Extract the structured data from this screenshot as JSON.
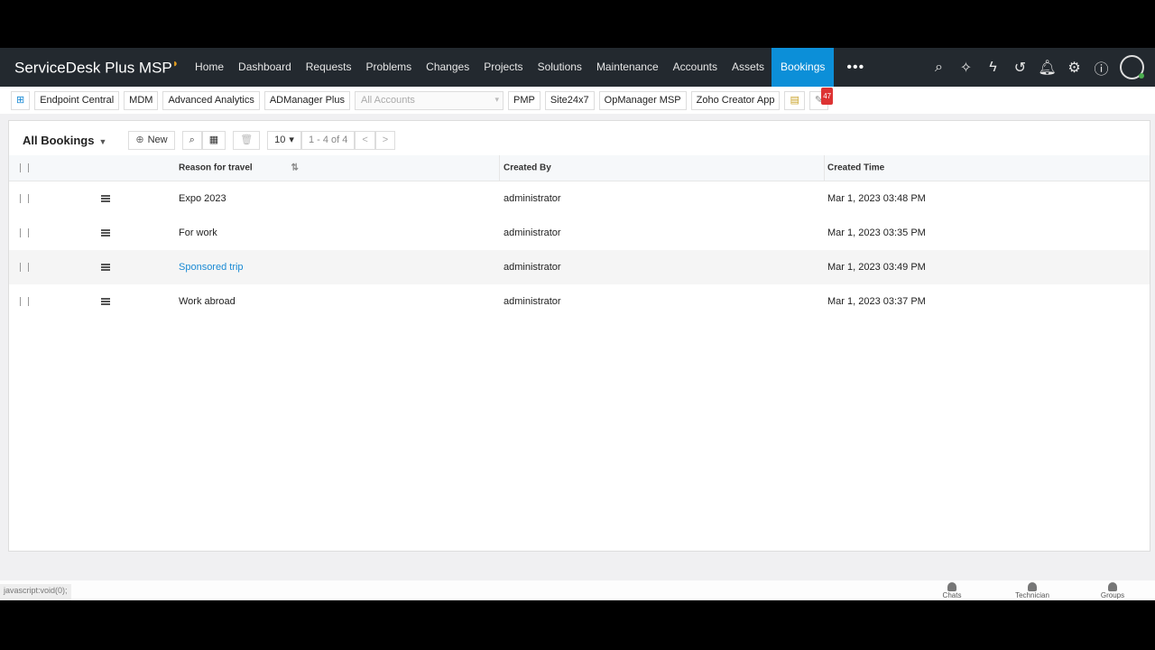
{
  "app": {
    "logo": "ServiceDesk Plus MSP"
  },
  "nav": {
    "items": [
      "Home",
      "Dashboard",
      "Requests",
      "Problems",
      "Changes",
      "Projects",
      "Solutions",
      "Maintenance",
      "Accounts",
      "Assets",
      "Bookings"
    ],
    "active": "Bookings",
    "more": "•••"
  },
  "toolbar": {
    "links": [
      "Endpoint Central",
      "MDM",
      "Advanced Analytics",
      "ADManager Plus"
    ],
    "account_select": "All Accounts",
    "links2": [
      "PMP",
      "Site24x7",
      "OpManager MSP",
      "Zoho Creator App"
    ],
    "badge": "47"
  },
  "list": {
    "view": "All Bookings",
    "new_label": "New",
    "per_page": "10",
    "range": "1 - 4 of 4",
    "columns": [
      "Reason for travel",
      "Created By",
      "Created Time"
    ],
    "rows": [
      {
        "reason": "Expo 2023",
        "created_by": "administrator",
        "created_time": "Mar 1, 2023 03:48 PM"
      },
      {
        "reason": "For work",
        "created_by": "administrator",
        "created_time": "Mar 1, 2023 03:35 PM"
      },
      {
        "reason": "Sponsored trip",
        "created_by": "administrator",
        "created_time": "Mar 1, 2023 03:49 PM"
      },
      {
        "reason": "Work abroad",
        "created_by": "administrator",
        "created_time": "Mar 1, 2023 03:37 PM"
      }
    ]
  },
  "footer": {
    "status": "javascript:void(0);",
    "chats": "Chats",
    "technician": "Technician",
    "groups": "Groups"
  },
  "colors": {
    "nav_bg": "#23292f",
    "active": "#0c8fd8",
    "link": "#1a8ad4"
  }
}
